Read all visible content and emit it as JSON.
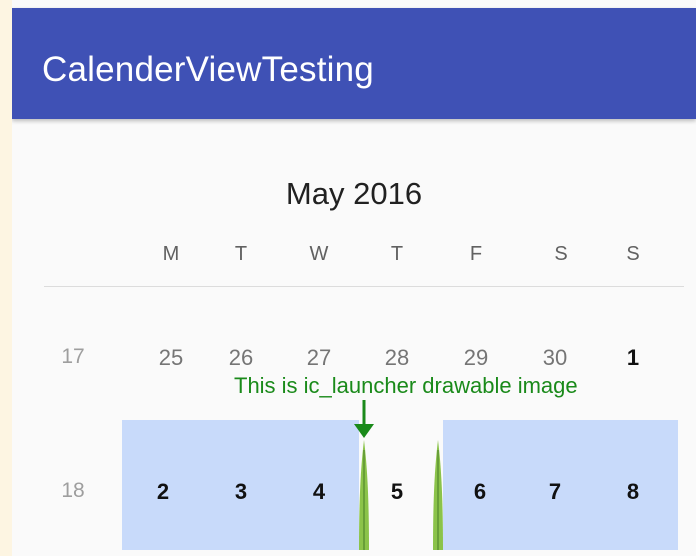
{
  "app": {
    "title": "CalenderViewTesting",
    "primary_color": "#3f51b5"
  },
  "calendar": {
    "month_title": "May 2016",
    "weekdays": [
      "M",
      "T",
      "W",
      "T",
      "F",
      "S",
      "S"
    ],
    "weeks": [
      {
        "number": "17",
        "days": [
          "25",
          "26",
          "27",
          "28",
          "29",
          "30",
          "1"
        ]
      },
      {
        "number": "18",
        "days": [
          "2",
          "3",
          "4",
          "5",
          "6",
          "7",
          "8"
        ]
      }
    ],
    "selected_date": "5",
    "selected_week_color": "#c8dafa"
  },
  "annotation": {
    "text": "This is ic_launcher drawable image",
    "color": "#1a8a1a",
    "icon": "down-arrow-icon"
  },
  "decor": {
    "drawable": "ic-launcher-leaf-icon"
  }
}
